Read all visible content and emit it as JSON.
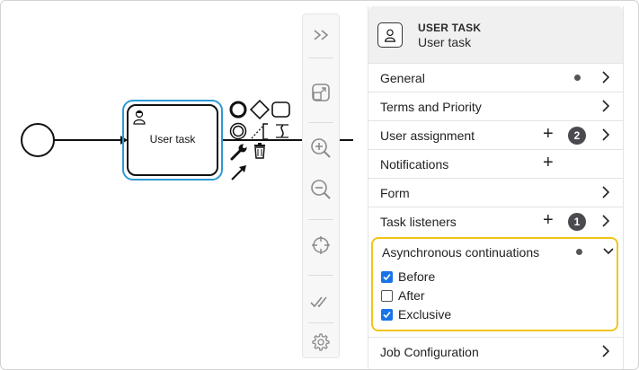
{
  "diagram": {
    "task_label": "User task"
  },
  "toolbar": {
    "buttons": [
      "collapse-panel",
      "fit-viewport",
      "zoom-in",
      "zoom-out",
      "center",
      "validate",
      "settings"
    ]
  },
  "panel": {
    "element_type": "USER TASK",
    "element_name": "User task",
    "groups": {
      "general": "General",
      "terms": "Terms and Priority",
      "user_assignment": "User assignment",
      "user_assignment_count": "2",
      "notifications": "Notifications",
      "form": "Form",
      "task_listeners": "Task listeners",
      "task_listeners_count": "1",
      "async": "Asynchronous continuations",
      "job_configuration": "Job Configuration"
    },
    "async_options": {
      "before": "Before",
      "after": "After",
      "exclusive": "Exclusive"
    },
    "async_checked": {
      "before": true,
      "after": false,
      "exclusive": true
    },
    "highlight_color": "#f0c419",
    "selection_color": "#2b9bd3"
  }
}
